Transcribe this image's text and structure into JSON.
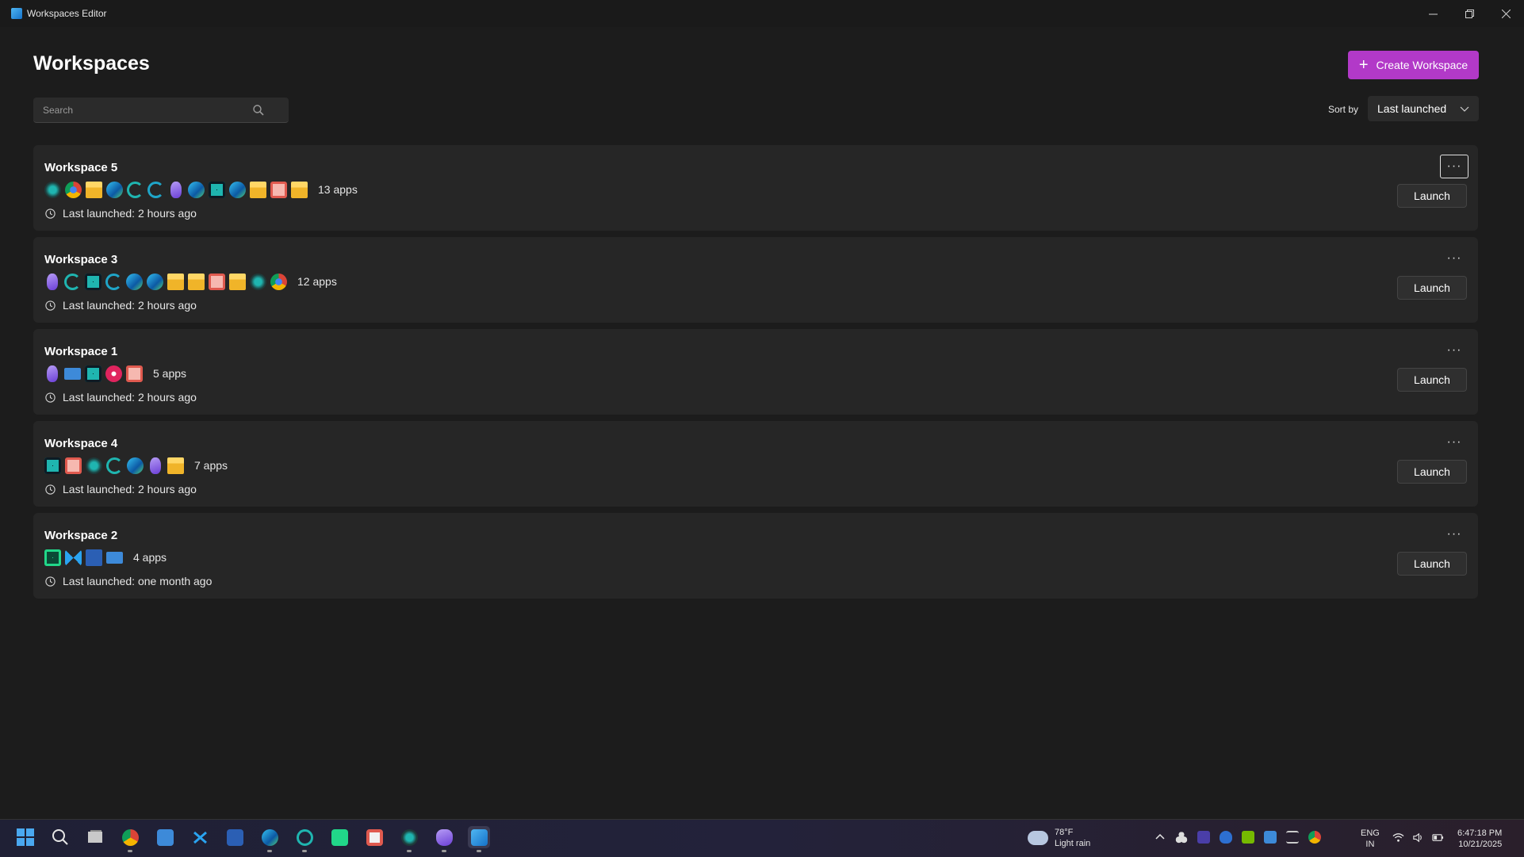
{
  "window": {
    "title": "Workspaces Editor"
  },
  "header": {
    "title": "Workspaces",
    "create_label": "Create Workspace",
    "search_placeholder": "Search",
    "sort_label": "Sort by",
    "sort_value": "Last launched"
  },
  "workspaces": [
    {
      "name": "Workspace 5",
      "apps_count": "13 apps",
      "launched": "Last launched: 2 hours ago",
      "launch_label": "Launch",
      "more_label": "···",
      "icons": [
        "obs-icon",
        "chrome-icon",
        "file-explorer-icon",
        "edge-icon",
        "edge-beta-icon",
        "edge-dev-icon",
        "obsidian-icon",
        "edge-icon",
        "mobaxterm-icon",
        "edge-icon",
        "file-explorer-icon",
        "snipping-tool-icon",
        "file-explorer-icon"
      ]
    },
    {
      "name": "Workspace 3",
      "apps_count": "12 apps",
      "launched": "Last launched: 2 hours ago",
      "launch_label": "Launch",
      "more_label": "···",
      "icons": [
        "obsidian-icon",
        "edge-beta-icon",
        "mobaxterm-icon",
        "edge-dev-icon",
        "edge-icon",
        "edge-icon",
        "file-explorer-icon",
        "file-explorer-icon",
        "snipping-tool-icon",
        "file-explorer-icon",
        "obs-icon",
        "chrome-icon"
      ]
    },
    {
      "name": "Workspace 1",
      "apps_count": "5 apps",
      "launched": "Last launched: 2 hours ago",
      "launch_label": "Launch",
      "more_label": "···",
      "icons": [
        "obsidian-icon",
        "remote-desktop-icon",
        "mobaxterm-icon",
        "media-player-icon",
        "snipping-tool-icon"
      ]
    },
    {
      "name": "Workspace 4",
      "apps_count": "7 apps",
      "launched": "Last launched: 2 hours ago",
      "launch_label": "Launch",
      "more_label": "···",
      "icons": [
        "mobaxterm-icon",
        "snipping-tool-icon",
        "obs-icon",
        "edge-beta-icon",
        "edge-icon",
        "obsidian-icon",
        "file-explorer-icon"
      ]
    },
    {
      "name": "Workspace 2",
      "apps_count": "4 apps",
      "launched": "Last launched: one month ago",
      "launch_label": "Launch",
      "more_label": "···",
      "icons": [
        "pycharm-icon",
        "vscode-icon",
        "word-icon",
        "remote-desktop-icon"
      ]
    }
  ],
  "taskbar": {
    "weather_temp": "78°F",
    "weather_desc": "Light rain",
    "lang_top": "ENG",
    "lang_bottom": "IN",
    "time": "6:47:18 PM",
    "date": "10/21/2025"
  },
  "colors": {
    "accent": "#b239c8",
    "background": "#1c1c1c",
    "card": "#262626"
  }
}
